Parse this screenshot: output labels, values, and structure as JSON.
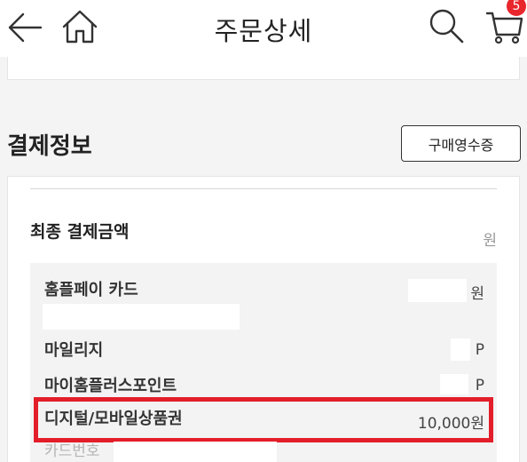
{
  "header": {
    "title": "주문상세",
    "cart_count": "5",
    "icons": [
      "back-arrow-icon",
      "home-icon",
      "search-icon",
      "cart-icon"
    ]
  },
  "payment": {
    "section_title": "결제정보",
    "receipt_button": "구매영수증",
    "final_amount_label": "최종 결제금액",
    "final_amount_value": "원",
    "rows": [
      {
        "label": "홈플페이 카드",
        "value": "원"
      },
      {
        "label": "마일리지",
        "value": "P"
      },
      {
        "label": "마이홈플러스포인트",
        "value": "P"
      },
      {
        "label": "디지털/모바일상품권",
        "value": "10,000원"
      },
      {
        "label": "카드번호",
        "value": ""
      }
    ]
  },
  "colors": {
    "accent": "#e31e2a",
    "badge": "#e8262c"
  }
}
